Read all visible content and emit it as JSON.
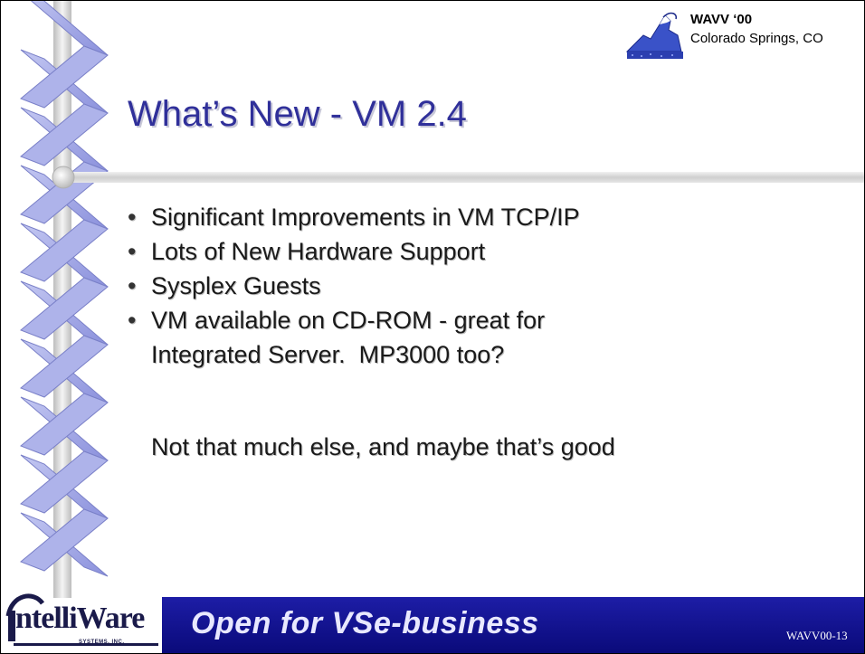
{
  "conference": {
    "name": "WAVV ‘00",
    "location": "Colorado Springs, CO",
    "logo_icon": "mountain-peak-icon"
  },
  "slide": {
    "title": "What’s New - VM 2.4",
    "bullets": [
      [
        "Significant Improvements in VM TCP/IP"
      ],
      [
        "Lots of New Hardware Support"
      ],
      [
        "Sysplex Guests"
      ],
      [
        "VM available on CD-ROM - great for",
        "Integrated Server.  MP3000 too?"
      ]
    ],
    "extra_text": "Not that much else, and maybe that’s good"
  },
  "footer": {
    "slogan": "Open for VSe-business",
    "slide_number": "WAVV00-13",
    "brand_name": "ntelliWare",
    "brand_sub": "SYSTEMS, INC.",
    "band_color": "#12128f"
  },
  "colors": {
    "title": "#30309a",
    "spiral": "#9ea3e6",
    "rule": "#d8d8d8"
  }
}
